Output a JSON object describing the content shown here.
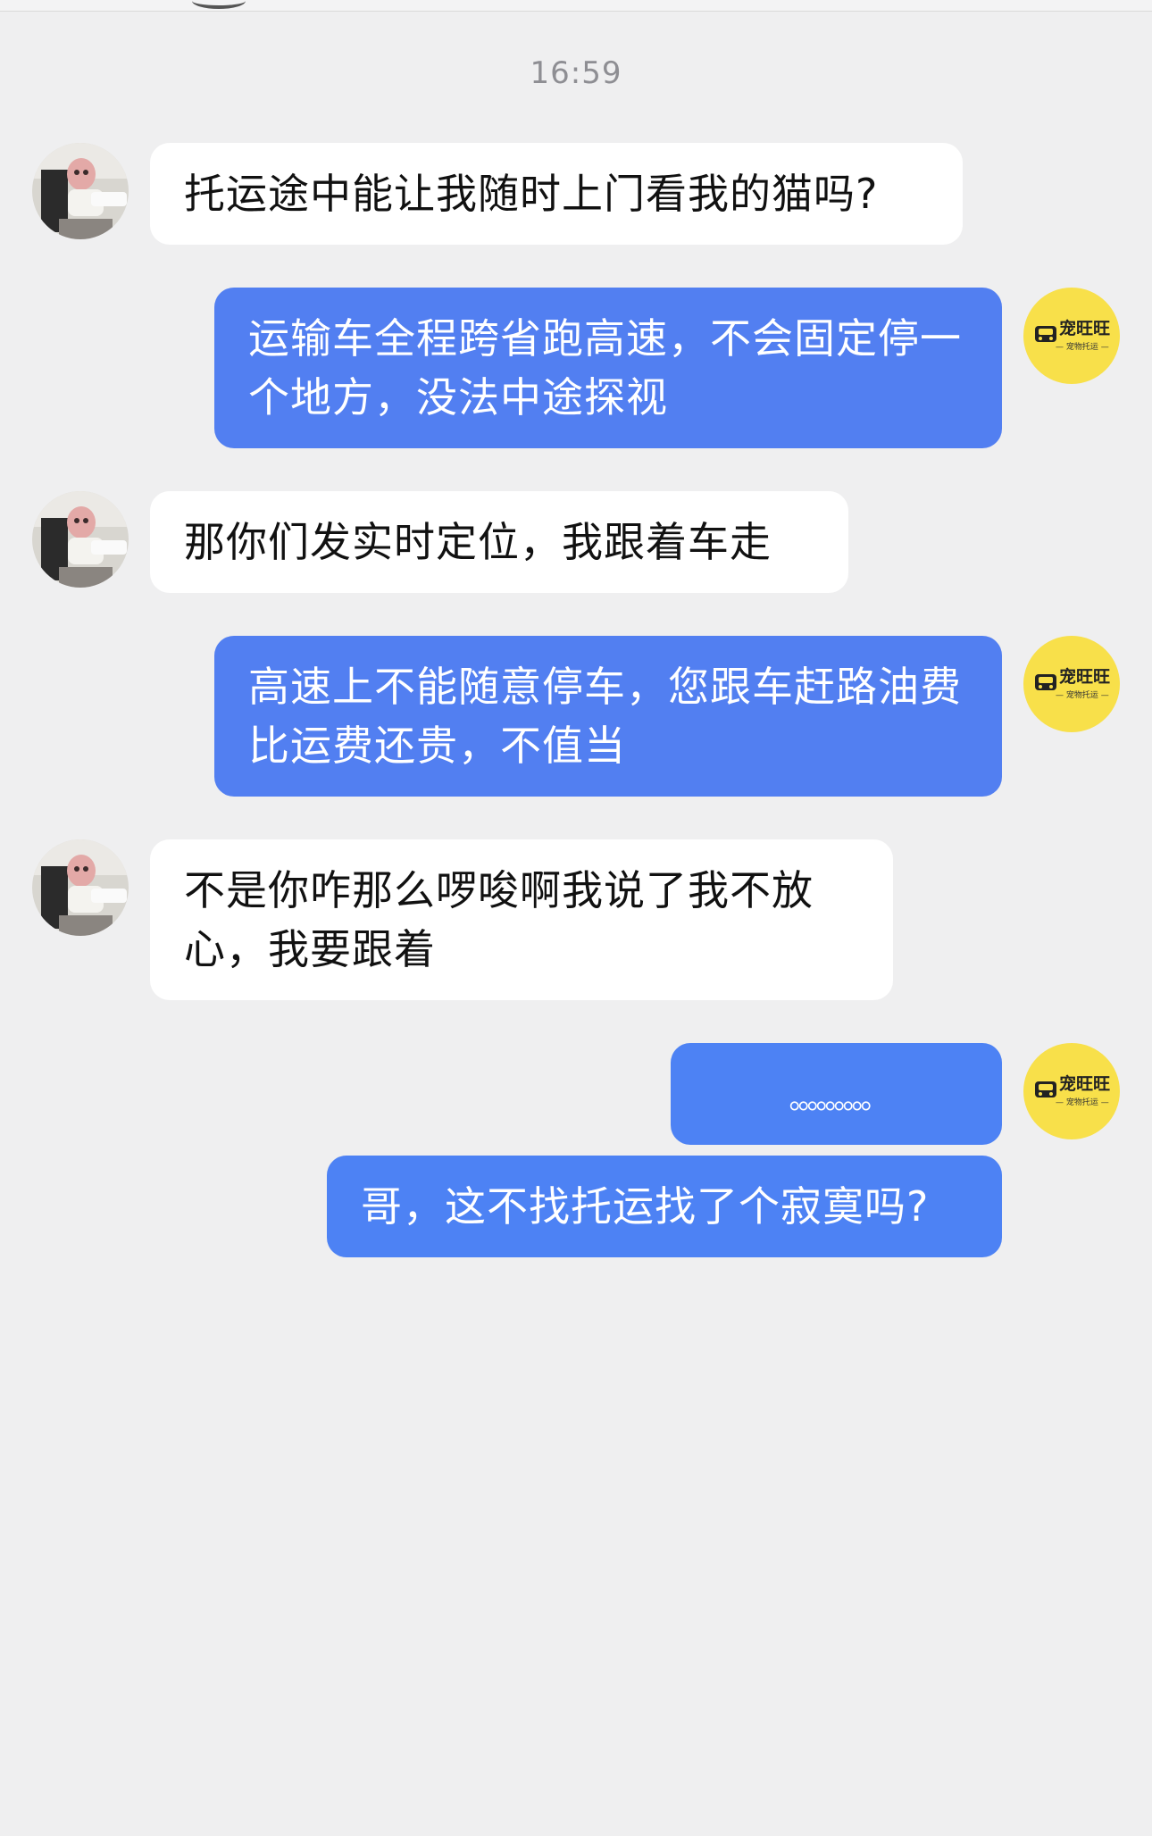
{
  "chat": {
    "timestamp": "16:59",
    "brand": {
      "name": "宠旺旺",
      "tagline": "— 宠物托运 —",
      "color": "#f8e04a"
    },
    "colors": {
      "incoming_bubble": "#ffffff",
      "outgoing_bubble": "#527ff1",
      "background": "#efeff0"
    },
    "messages": [
      {
        "sender": "customer",
        "text": "托运途中能让我随时上门看我的猫吗?"
      },
      {
        "sender": "agent",
        "text": "运输车全程跨省跑高速，不会固定停一个地方，没法中途探视"
      },
      {
        "sender": "customer",
        "text": "那你们发实时定位，我跟着车走"
      },
      {
        "sender": "agent",
        "text": "高速上不能随意停车，您跟车赶路油费比运费还贵，不值当"
      },
      {
        "sender": "customer",
        "text": "不是你咋那么啰唆啊我说了我不放心，我要跟着"
      },
      {
        "sender": "agent",
        "text": "。。。。。。。。。"
      },
      {
        "sender": "agent",
        "text": "哥，这不找托运找了个寂寞吗?"
      }
    ]
  }
}
